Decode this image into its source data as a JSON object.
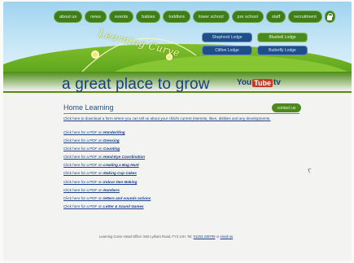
{
  "nav": {
    "items": [
      "about us",
      "news",
      "events",
      "babies",
      "toddlers",
      "lower school",
      "pre school",
      "staff",
      "recruitment"
    ]
  },
  "logo": {
    "text": "Learning Curve"
  },
  "lodges": [
    "Shepherd Lodge",
    "Bluebell Lodge",
    "Clifton Lodge",
    "Butterfly Lodge"
  ],
  "tagline": "a great place to grow",
  "youtube": {
    "you": "You",
    "tube": "Tube",
    "tv": "tv"
  },
  "section": {
    "title": "Home Learning",
    "contact_label": "contact us",
    "intro": "Click here to download a form where you can tell us about your child's current interests, likes, dislikes and any developments."
  },
  "pdf_prefix": "Click here for a PDF on ",
  "pdf_topics": [
    "Handwriting",
    "Dressing",
    "Counting",
    "Hand-Eye Coordination",
    "creating a Bug Hunt",
    "Making Cup Cakes",
    "Indoor Den Making",
    "Numbers",
    "letters and sounds actions",
    "Letter & Sound Games"
  ],
  "footer": {
    "text": "Learning Curve Head Office: 592 Lytham Road, FY4 1JH. Tel:",
    "phone": "01253 346700",
    "or": "or",
    "email": "email us"
  },
  "colors": {
    "nav_green": "#3f7d18",
    "lodge_blue": "#1f4f86",
    "tagline_blue": "#1a3f7d"
  }
}
